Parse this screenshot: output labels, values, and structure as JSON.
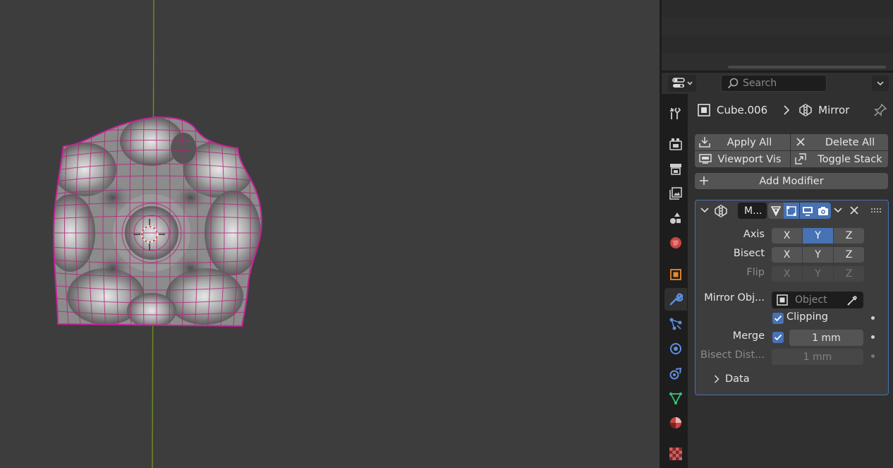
{
  "properties": {
    "search_placeholder": "Search",
    "breadcrumb": {
      "object": "Cube.006",
      "modifier": "Mirror"
    },
    "actions": {
      "apply_all": "Apply All",
      "delete_all": "Delete All",
      "viewport_vis": "Viewport Vis",
      "toggle_stack": "Toggle Stack",
      "add_modifier": "Add Modifier"
    },
    "modifier": {
      "name": "M...",
      "axis_label": "Axis",
      "bisect_label": "Bisect",
      "flip_label": "Flip",
      "axis_x": "X",
      "axis_y": "Y",
      "axis_z": "Z",
      "mirror_object_label": "Mirror Obj...",
      "mirror_object_placeholder": "Object",
      "clipping_label": "Clipping",
      "merge_label": "Merge",
      "merge_value": "1 mm",
      "bisect_distance_label": "Bisect Dist...",
      "bisect_distance_value": "1 mm",
      "data_subpanel": "Data",
      "axis_state": {
        "x": false,
        "y": true,
        "z": false
      },
      "bisect_state": {
        "x": false,
        "y": false,
        "z": false
      },
      "clipping": true,
      "merge": true
    },
    "tabs": [
      "tool-tab",
      "render-tab",
      "output-tab",
      "view-layer-tab",
      "scene-tab",
      "world-tab",
      "object-tab",
      "modifiers-tab",
      "particles-tab",
      "physics-tab",
      "constraints-tab",
      "data-tab",
      "material-tab",
      "texture-tab"
    ],
    "active_tab": "modifiers-tab"
  },
  "colors": {
    "accent": "#4772b3",
    "mesh_edge": "#b0287a",
    "y_axis": "#6e8a1e"
  }
}
